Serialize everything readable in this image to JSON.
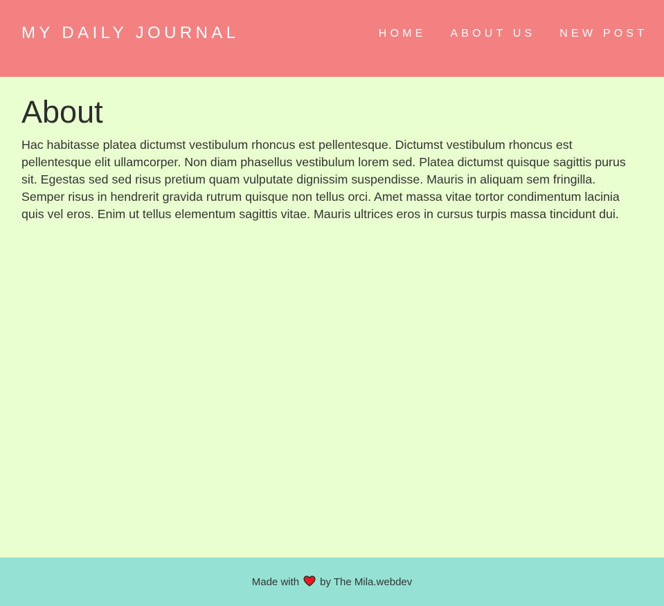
{
  "header": {
    "brand": "MY DAILY JOURNAL",
    "nav": [
      {
        "label": "HOME"
      },
      {
        "label": "ABOUT US"
      },
      {
        "label": "NEW POST"
      }
    ]
  },
  "main": {
    "title": "About",
    "body": "Hac habitasse platea dictumst vestibulum rhoncus est pellentesque. Dictumst vestibulum rhoncus est pellentesque elit ullamcorper. Non diam phasellus vestibulum lorem sed. Platea dictumst quisque sagittis purus sit. Egestas sed sed risus pretium quam vulputate dignissim suspendisse. Mauris in aliquam sem fringilla. Semper risus in hendrerit gravida rutrum quisque non tellus orci. Amet massa vitae tortor condimentum lacinia quis vel eros. Enim ut tellus elementum sagittis vitae. Mauris ultrices eros in cursus turpis massa tincidunt dui."
  },
  "footer": {
    "prefix": "Made with",
    "icon": "heart-icon",
    "suffix": "by The Mila.webdev"
  },
  "colors": {
    "navbar": "#f38181",
    "background": "#eaffd0",
    "footer": "#95e1d3",
    "heart": "#e8191f"
  }
}
